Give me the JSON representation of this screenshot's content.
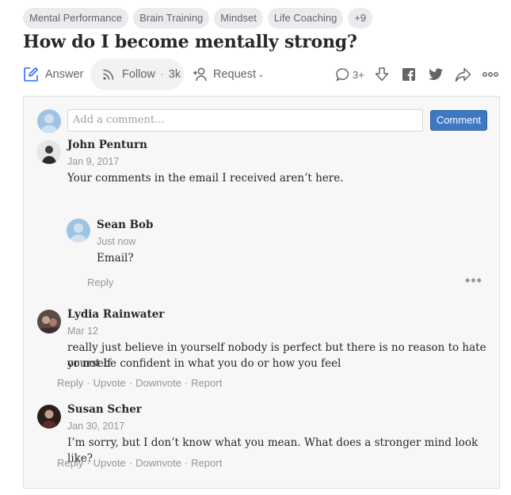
{
  "topics": [
    "Mental Performance",
    "Brain Training",
    "Mindset",
    "Life Coaching",
    "+9"
  ],
  "question": {
    "title": "How do I become mentally strong?"
  },
  "actions": {
    "answer_label": "Answer",
    "follow_label": "Follow",
    "follow_dot": "·",
    "follow_count": "3k",
    "request_label": "Request",
    "request_caret": "⌄",
    "comments_count": "3+"
  },
  "comment_box": {
    "placeholder": "Add a comment...",
    "button_label": "Comment"
  },
  "comments": [
    {
      "name": "John Penturn",
      "date": "Jan 9, 2017",
      "text": "Your comments in the email I received aren’t here."
    },
    {
      "name": "Sean Bob",
      "date": "Just now",
      "text": "Email?"
    },
    {
      "name": "Lydia Rainwater",
      "date": "Mar 12",
      "text_line1": "really just believe in yourself nobody is perfect but there is no reason to hate yourself",
      "text_line2": "or not be confident in what you do or how you feel"
    },
    {
      "name": "Susan Scher",
      "date": "Jan 30, 2017",
      "text": "I’m sorry, but I don’t know what you mean. What does a stronger mind look like?"
    }
  ],
  "comment_actions": {
    "reply": "Reply",
    "upvote": "Upvote",
    "downvote": "Downvote",
    "report": "Report",
    "sep": "·",
    "more": "•••"
  },
  "icons": {
    "answer": "pencil-square-icon",
    "follow": "rss-icon",
    "request": "person-plus-icon",
    "comment": "speech-bubble-icon",
    "downvote": "down-arrow-icon",
    "facebook": "facebook-icon",
    "twitter": "twitter-icon",
    "share": "share-arrow-icon",
    "more": "more-dots-icon"
  },
  "colors": {
    "accent_blue": "#3e78c2",
    "answer_icon": "#2e69ff",
    "topic_bg": "#ebebef",
    "panel_bg": "#f7f7f8"
  }
}
